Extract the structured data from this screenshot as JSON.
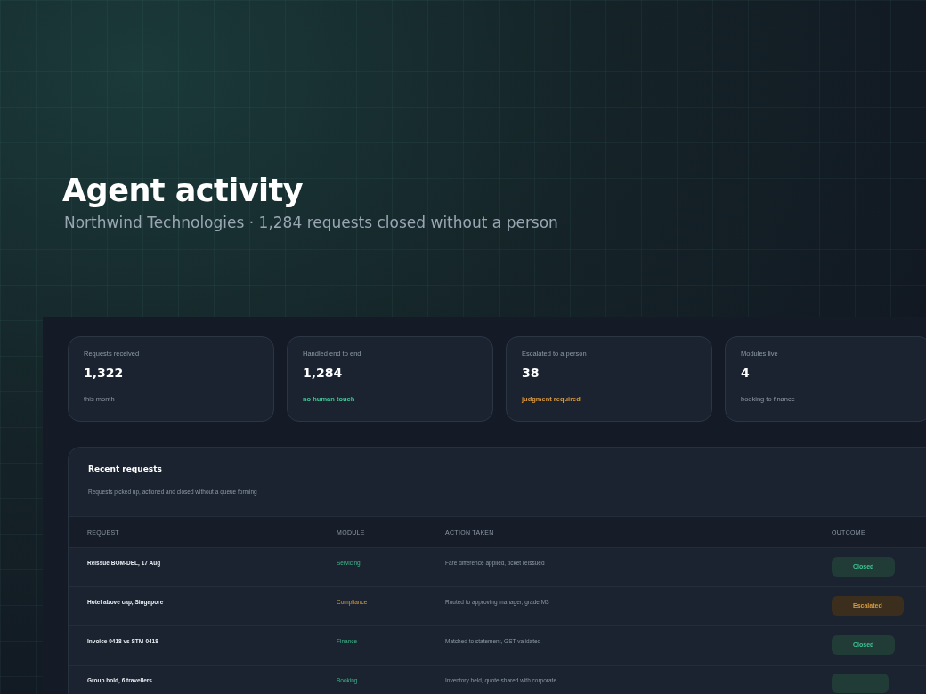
{
  "hero": {
    "title": "Agent activity",
    "subtitle": "Northwind Technologies · 1,284 requests closed without a person"
  },
  "stats": [
    {
      "label": "Requests received",
      "value": "1,322",
      "note": "this month",
      "kind": "plain"
    },
    {
      "label": "Handled end to end",
      "value": "1,284",
      "note": "no human touch",
      "kind": "good"
    },
    {
      "label": "Escalated to a person",
      "value": "38",
      "note": "judgment required",
      "kind": "warn"
    },
    {
      "label": "Modules live",
      "value": "4",
      "note": "booking to finance",
      "kind": "plain"
    }
  ],
  "requests": {
    "title": "Recent requests",
    "subtitle": "Requests picked up, actioned and closed without a queue forming",
    "columns": [
      "REQUEST",
      "MODULE",
      "ACTION TAKEN",
      "OUTCOME"
    ],
    "rows": [
      {
        "request": "Reissue BOM-DEL, 17 Aug",
        "module": "Servicing",
        "action": "Fare difference applied, ticket reissued",
        "outcome": {
          "kind": "closed",
          "label": "Closed"
        }
      },
      {
        "request": "Hotel above cap, Singapore",
        "module": "Compliance",
        "action": "Routed to approving manager, grade M3",
        "outcome": {
          "kind": "escalated",
          "label": "Escalated"
        }
      },
      {
        "request": "Invoice 0418 vs STM-0418",
        "module": "Finance",
        "action": "Matched to statement, GST validated",
        "outcome": {
          "kind": "closed",
          "label": "Closed"
        }
      },
      {
        "request": "Group hold, 6 travellers",
        "module": "Booking",
        "action": "Inventory held, quote shared with corporate",
        "outcome": {
          "kind": "closed"
        }
      }
    ]
  }
}
